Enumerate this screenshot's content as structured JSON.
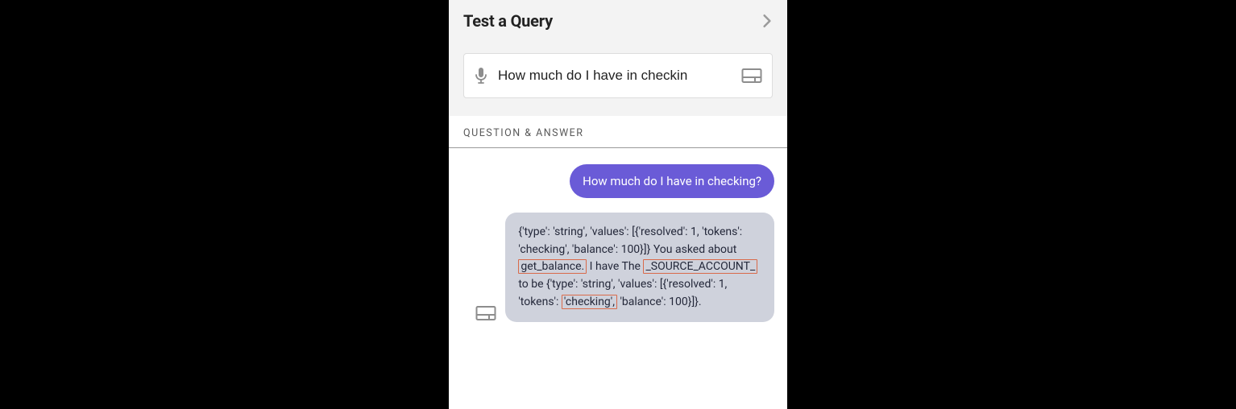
{
  "header": {
    "title": "Test a Query"
  },
  "input": {
    "value": "How much do I have in checkin"
  },
  "section": {
    "label": "QUESTION & ANSWER"
  },
  "conversation": {
    "user_message": "How much do I have in checking?",
    "bot_response": {
      "pre1": "{'type': 'string', 'values': [{'resolved': 1, 'tokens': 'checking', 'balance': 100}]} You asked about ",
      "hl1": "get_balance.",
      "mid1": " I have The ",
      "hl2": "_SOURCE_ACCOUNT_",
      "mid2": " to be {'type': 'string', 'values': [{'resolved': 1, 'tokens': ",
      "hl3": "'checking',",
      "post": " 'balance': 100}]}."
    }
  }
}
